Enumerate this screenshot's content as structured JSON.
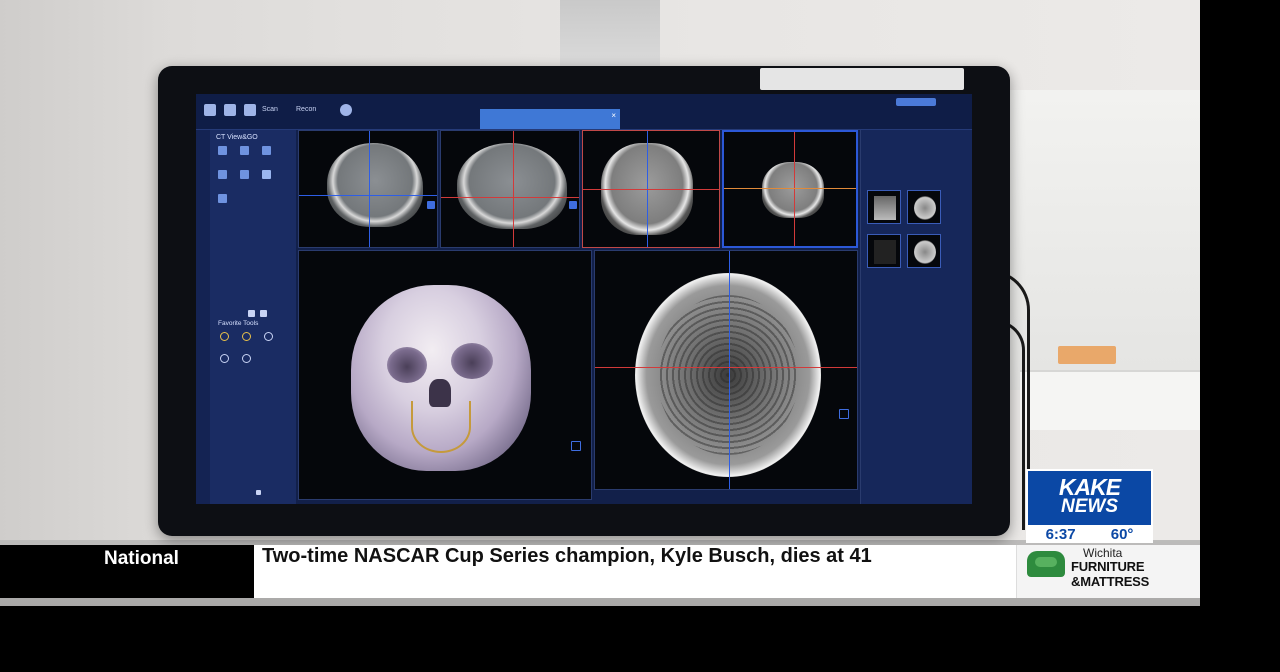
{
  "ticker": {
    "category": "National",
    "headline": "Two-time NASCAR Cup Series champion, Kyle Busch, dies at 41"
  },
  "station_bug": {
    "logo_top": "KAKE",
    "logo_bottom": "NEWS",
    "time": "6:37",
    "temperature": "60°",
    "brand_color": "#0b48a5"
  },
  "sponsor": {
    "line1": "Wichita",
    "line2": "FURNITURE &MATTRESS",
    "icon": "armchair-icon",
    "brand_color": "#2e8b3e"
  },
  "ct_screen": {
    "toolbar": {
      "scan_label": "Scan",
      "recon_label": "Recon"
    },
    "side_panel": {
      "title": "CT View&GO",
      "favorite_tools_title": "Favorite Tools"
    }
  },
  "colors": {
    "screen_bg": "#12204a",
    "crosshair_blue": "#2e5ee6",
    "crosshair_red": "#d23a3a"
  }
}
